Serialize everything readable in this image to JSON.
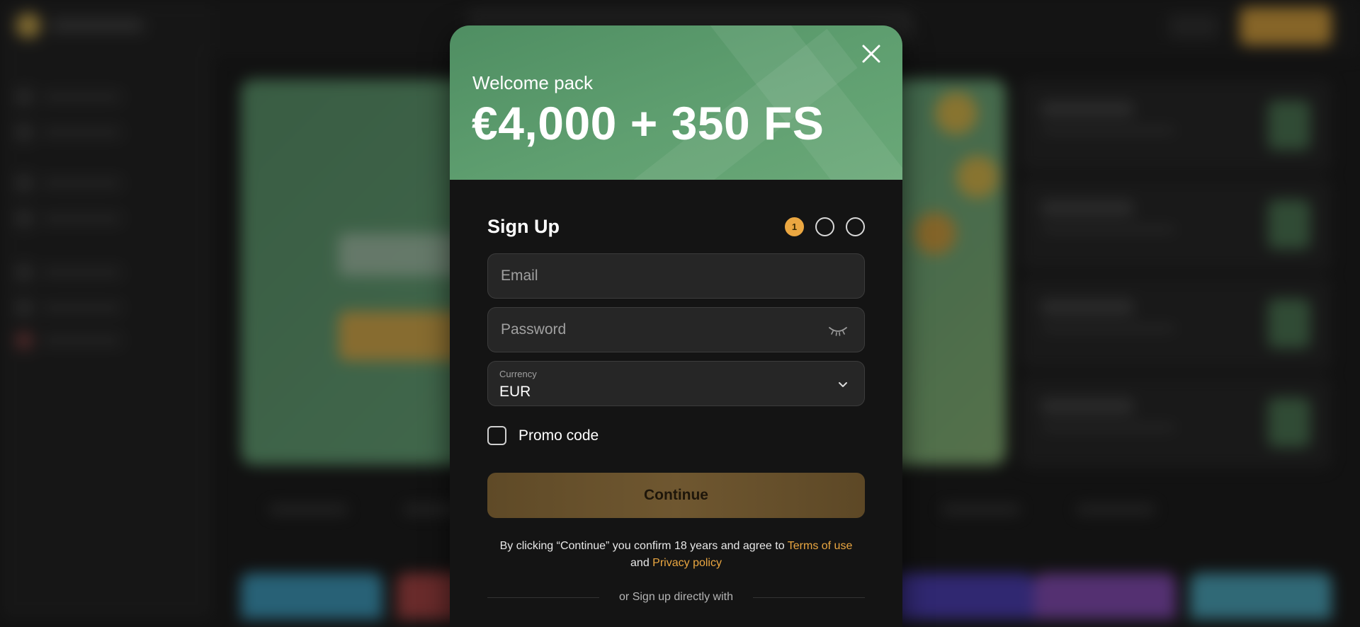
{
  "modal": {
    "welcome_label": "Welcome pack",
    "welcome_amount": "€4,000 + 350 FS",
    "signup_title": "Sign Up",
    "steps": [
      "1",
      "",
      ""
    ],
    "email_placeholder": "Email",
    "password_placeholder": "Password",
    "currency_label": "Currency",
    "currency_value": "EUR",
    "promo_label": "Promo code",
    "continue_label": "Continue",
    "legal_text": "By clicking “Continue” you confirm 18 years and agree to",
    "terms_link": "Terms of use",
    "legal_and": "and",
    "privacy_link": "Privacy policy",
    "divider_text": "or Sign up directly with"
  },
  "colors": {
    "header_green": "#5f9f70",
    "accent_orange": "#eba741",
    "modal_bg": "#141414",
    "field_bg": "#262626"
  },
  "icons": [
    "close-icon",
    "eye-closed-icon",
    "chevron-down-icon",
    "checkbox-icon"
  ]
}
